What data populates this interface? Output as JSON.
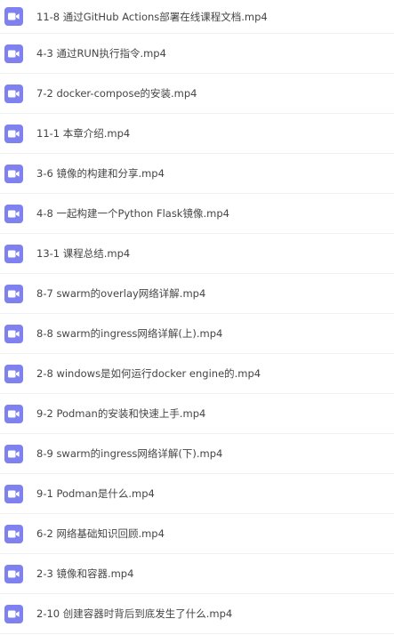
{
  "files": [
    {
      "name": "11-8 通过GitHub Actions部署在线课程文档.mp4",
      "icon": "video-file-icon"
    },
    {
      "name": "4-3 通过RUN执行指令.mp4",
      "icon": "video-file-icon"
    },
    {
      "name": "7-2 docker-compose的安装.mp4",
      "icon": "video-file-icon"
    },
    {
      "name": "11-1 本章介绍.mp4",
      "icon": "video-file-icon"
    },
    {
      "name": "3-6 镜像的构建和分享.mp4",
      "icon": "video-file-icon"
    },
    {
      "name": "4-8 一起构建一个Python Flask镜像.mp4",
      "icon": "video-file-icon"
    },
    {
      "name": "13-1 课程总结.mp4",
      "icon": "video-file-icon"
    },
    {
      "name": "8-7 swarm的overlay网络详解.mp4",
      "icon": "video-file-icon"
    },
    {
      "name": "8-8 swarm的ingress网络详解(上).mp4",
      "icon": "video-file-icon"
    },
    {
      "name": "2-8 windows是如何运行docker engine的.mp4",
      "icon": "video-file-icon"
    },
    {
      "name": "9-2 Podman的安装和快速上手.mp4",
      "icon": "video-file-icon"
    },
    {
      "name": "8-9 swarm的ingress网络详解(下).mp4",
      "icon": "video-file-icon"
    },
    {
      "name": "9-1 Podman是什么.mp4",
      "icon": "video-file-icon"
    },
    {
      "name": "6-2 网络基础知识回顾.mp4",
      "icon": "video-file-icon"
    },
    {
      "name": "2-3 镜像和容器.mp4",
      "icon": "video-file-icon"
    },
    {
      "name": "2-10 创建容器时背后到底发生了什么.mp4",
      "icon": "video-file-icon"
    }
  ],
  "colors": {
    "icon_background": "#7f82ee",
    "text": "#454545",
    "divider": "#f0f0f0"
  }
}
